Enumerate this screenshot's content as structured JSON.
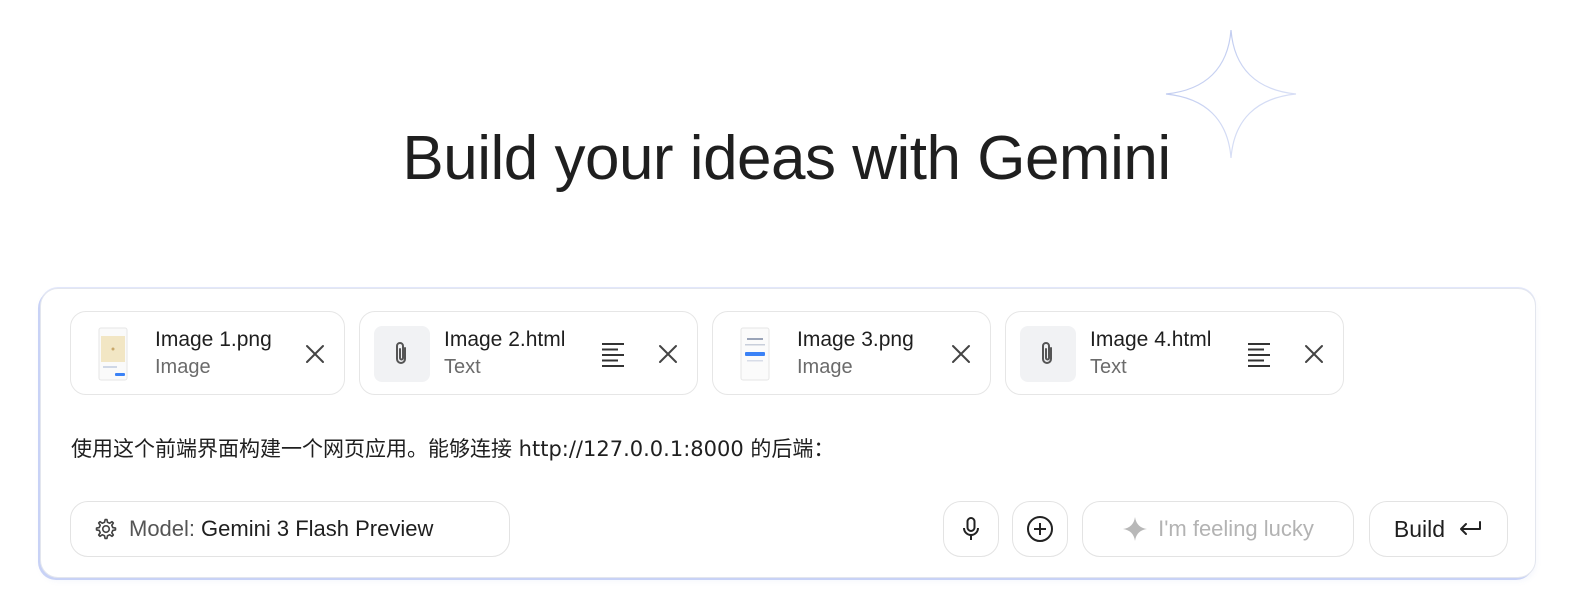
{
  "hero": {
    "title": "Build your ideas with Gemini"
  },
  "attachments": [
    {
      "name": "Image 1.png",
      "kind": "Image",
      "thumb": "image-thumbnail"
    },
    {
      "name": "Image 2.html",
      "kind": "Text",
      "thumb": "paperclip-icon"
    },
    {
      "name": "Image 3.png",
      "kind": "Image",
      "thumb": "image-thumbnail"
    },
    {
      "name": "Image 4.html",
      "kind": "Text",
      "thumb": "paperclip-icon"
    }
  ],
  "prompt": {
    "value": "使用这个前端界面构建一个网页应用。能够连接 http://127.0.0.1:8000 的后端："
  },
  "toolbar": {
    "model_prefix": "Model:",
    "model_value": "Gemini 3 Flash Preview",
    "lucky_label": "I'm feeling lucky",
    "build_label": "Build"
  },
  "icons": {
    "model": "gear-icon",
    "mic": "microphone-icon",
    "add": "plus-circle-icon",
    "lucky": "sparkle-icon",
    "build": "enter-arrow-icon",
    "view_text": "text-lines-icon",
    "remove": "close-icon"
  },
  "colors": {
    "accent_border": "#c8d2f6",
    "muted_text": "#6b6b6b",
    "disabled_text": "#b3b3b3"
  }
}
